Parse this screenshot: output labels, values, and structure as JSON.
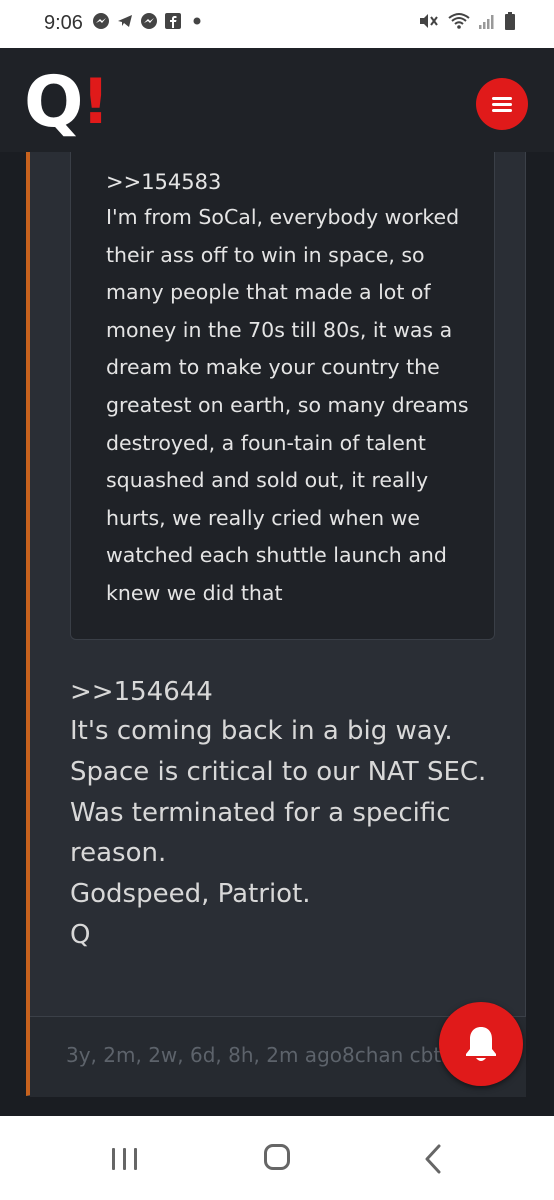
{
  "status_bar": {
    "time": "9:06",
    "notification_icons": [
      "messenger-icon",
      "telegram-icon",
      "messenger-icon",
      "facebook-icon",
      "dot-icon"
    ],
    "system_icons": [
      "mute-icon",
      "wifi-icon",
      "signal-icon",
      "battery-icon"
    ]
  },
  "header": {
    "logo_q": "Q",
    "logo_bang": "!",
    "menu_icon": "hamburger-icon",
    "accent_color": "#e01a1a"
  },
  "post": {
    "accent_border_color": "#c7621e",
    "quoted": {
      "ref": ">>154583",
      "text": "I'm from SoCal, everybody worked their ass off to win in space, so many people that made a lot of money in the 70s till 80s, it was a dream to make your country the greatest on earth, so many dreams destroyed, a foun-tain of talent squashed and sold out, it really hurts, we really cried when we watched each shuttle launch and knew we did that"
    },
    "reply": {
      "ref": ">>154644",
      "lines": [
        "It's coming back in a big way.",
        "Space is critical to our NAT SEC.",
        "Was terminated for a specific reason.",
        "Godspeed, Patriot.",
        "Q"
      ]
    },
    "footer": "3y, 2m, 2w, 6d, 8h, 2m ago8chan cbts"
  },
  "notification_button": {
    "icon": "bell-icon"
  },
  "nav_bar": {
    "icons": [
      "recent-apps-icon",
      "home-icon",
      "back-icon"
    ]
  }
}
